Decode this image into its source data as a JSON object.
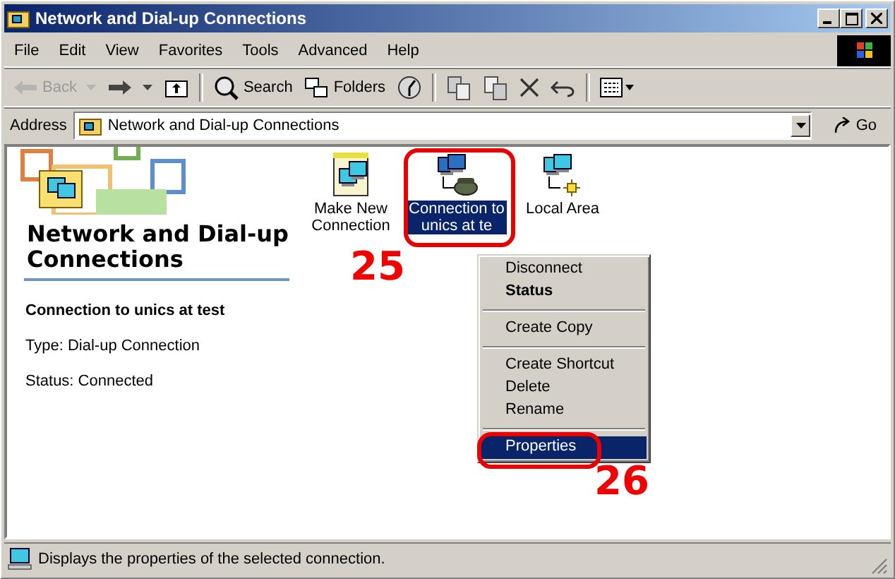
{
  "window": {
    "title": "Network and Dial-up Connections"
  },
  "menu": [
    "File",
    "Edit",
    "View",
    "Favorites",
    "Tools",
    "Advanced",
    "Help"
  ],
  "toolbar": [
    {
      "kind": "back",
      "label": "Back",
      "disabled": true
    },
    {
      "kind": "forward",
      "disabled": false
    },
    {
      "kind": "up",
      "disabled": false
    },
    {
      "kind": "sep"
    },
    {
      "kind": "search",
      "label": "Search",
      "disabled": false
    },
    {
      "kind": "folders",
      "label": "Folders",
      "disabled": false
    },
    {
      "kind": "history",
      "disabled": false
    },
    {
      "kind": "sep"
    },
    {
      "kind": "move",
      "disabled": false
    },
    {
      "kind": "copy",
      "disabled": false
    },
    {
      "kind": "delete",
      "disabled": false
    },
    {
      "kind": "undo",
      "disabled": false
    },
    {
      "kind": "sep"
    },
    {
      "kind": "views",
      "disabled": false
    }
  ],
  "address": {
    "label": "Address",
    "value": "Network and Dial-up Connections",
    "go": "Go"
  },
  "left_pane": {
    "title": "Network and Dial-up Connections",
    "name": "Connection to unics at test",
    "details": [
      "Type: Dial-up Connection",
      "Status: Connected"
    ]
  },
  "icons": [
    {
      "kind": "wizard",
      "label": "Make New Connection",
      "selected": false
    },
    {
      "kind": "dialup",
      "label": "Connection to unics at te",
      "selected": true,
      "annotation": "25"
    },
    {
      "kind": "lan",
      "label": "Local Area",
      "selected": false
    }
  ],
  "context_menu": [
    {
      "kind": "item",
      "label": "Disconnect",
      "default": false,
      "selected": false
    },
    {
      "kind": "item",
      "label": "Status",
      "default": true,
      "selected": false
    },
    {
      "kind": "separator"
    },
    {
      "kind": "item",
      "label": "Create Copy",
      "default": false,
      "selected": false
    },
    {
      "kind": "separator"
    },
    {
      "kind": "item",
      "label": "Create Shortcut",
      "default": false,
      "selected": false
    },
    {
      "kind": "item",
      "label": "Delete",
      "default": false,
      "selected": false
    },
    {
      "kind": "item",
      "label": "Rename",
      "default": false,
      "selected": false
    },
    {
      "kind": "separator"
    },
    {
      "kind": "item",
      "label": "Properties",
      "default": false,
      "selected": true,
      "annotation": "26"
    }
  ],
  "status_bar": {
    "text": "Displays the properties of the selected connection."
  }
}
